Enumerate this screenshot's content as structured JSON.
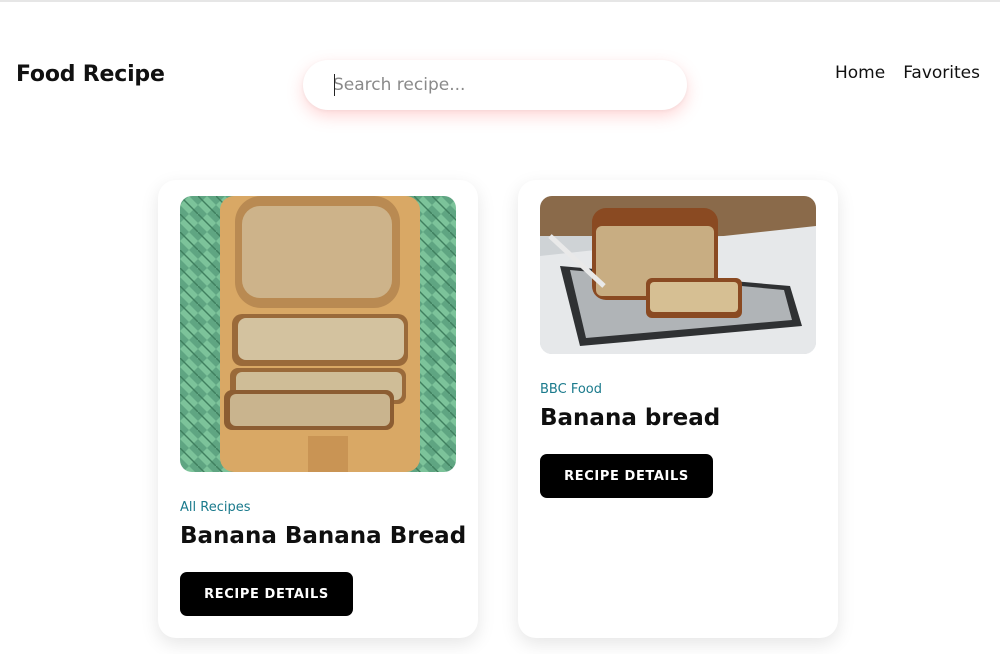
{
  "header": {
    "brand": "Food Recipe",
    "search": {
      "placeholder": "Search recipe...",
      "value": ""
    },
    "nav": {
      "home": "Home",
      "favorites": "Favorites"
    }
  },
  "recipes": [
    {
      "source": "All Recipes",
      "title": "Banana Banana Bread",
      "button": "RECIPE DETAILS"
    },
    {
      "source": "BBC Food",
      "title": "Banana bread",
      "button": "RECIPE DETAILS"
    }
  ],
  "colors": {
    "accent": "#1a7a8c",
    "button_bg": "#000000",
    "search_glow": "#ff7878"
  }
}
